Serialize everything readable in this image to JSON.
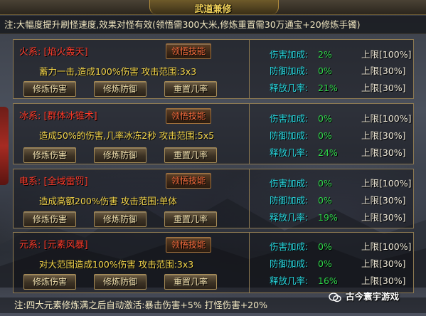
{
  "window": {
    "title": "武道兼修"
  },
  "note_top": "注:大幅度提升刷怪速度,效果对怪有效(领悟需300大米,修炼重置需30万通宝+20修炼手镯)",
  "note_bottom": "注:四大元素修炼满之后自动激活:暴击伤害+5% 打怪伤害+20%",
  "watermark": "古今寰宇游戏",
  "buttons": {
    "learn": "领悟技能",
    "train_damage": "修炼伤害",
    "train_defense": "修炼防御",
    "reset_chance": "重置几率"
  },
  "stat_labels": {
    "damage": "伤害加成:",
    "defense": "防御加成:",
    "chance": "释放几率:"
  },
  "elements": [
    {
      "label": "火系:",
      "skill": "[焰火轰天]",
      "desc": "蓄力一击,造成100%伤害  攻击范围:3x3",
      "damage_bonus": "2%",
      "damage_limit": "上限[100%]",
      "defense_bonus": "0%",
      "defense_limit": "上限[30%]",
      "release_chance": "21%",
      "chance_limit": "上限[30%]"
    },
    {
      "label": "冰系:",
      "skill": "[群体冰锥术]",
      "desc": "造成50%的伤害,几率冰冻2秒  攻击范围:5x5",
      "damage_bonus": "0%",
      "damage_limit": "上限[100%]",
      "defense_bonus": "0%",
      "defense_limit": "上限[30%]",
      "release_chance": "24%",
      "chance_limit": "上限[30%]"
    },
    {
      "label": "电系:",
      "skill": "[全域雷罚]",
      "desc": "造成高额200%伤害  攻击范围:单体",
      "damage_bonus": "0%",
      "damage_limit": "上限[100%]",
      "defense_bonus": "0%",
      "defense_limit": "上限[30%]",
      "release_chance": "19%",
      "chance_limit": "上限[30%]"
    },
    {
      "label": "元系:",
      "skill": "[元素风暴]",
      "desc": "对大范围造成100%伤害  攻击范围:3x3",
      "damage_bonus": "0%",
      "damage_limit": "上限[100%]",
      "defense_bonus": "0%",
      "defense_limit": "上限[30%]",
      "release_chance": "16%",
      "chance_limit": "上限[30%]"
    }
  ]
}
